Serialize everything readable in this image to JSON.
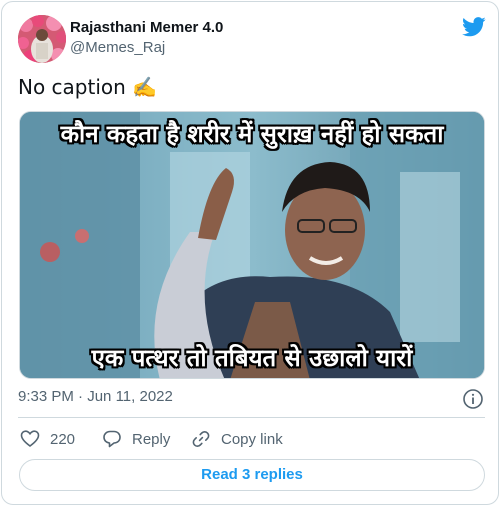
{
  "author": {
    "display_name": "Rajasthani Memer 4.0",
    "handle": "@Memes_Raj"
  },
  "tweet": {
    "text": "No caption ✍️"
  },
  "media": {
    "caption_top": "कौन कहता है शरीर में सुराख़ नहीं हो सकता",
    "caption_bottom": "एक पत्थर तो तबियत से उछालो यारों"
  },
  "meta": {
    "time": "9:33 PM",
    "separator": "·",
    "date": "Jun 11, 2022"
  },
  "actions": {
    "like_count": "220",
    "reply_label": "Reply",
    "copy_label": "Copy link"
  },
  "replies_button": "Read 3 replies",
  "colors": {
    "brand_blue": "#1d9bf0",
    "like_red": "#f91880",
    "text_secondary": "#536471",
    "border": "#cfd9de"
  },
  "icons": [
    "twitter-logo-icon",
    "info-icon",
    "heart-icon",
    "reply-bubble-icon",
    "link-icon"
  ]
}
